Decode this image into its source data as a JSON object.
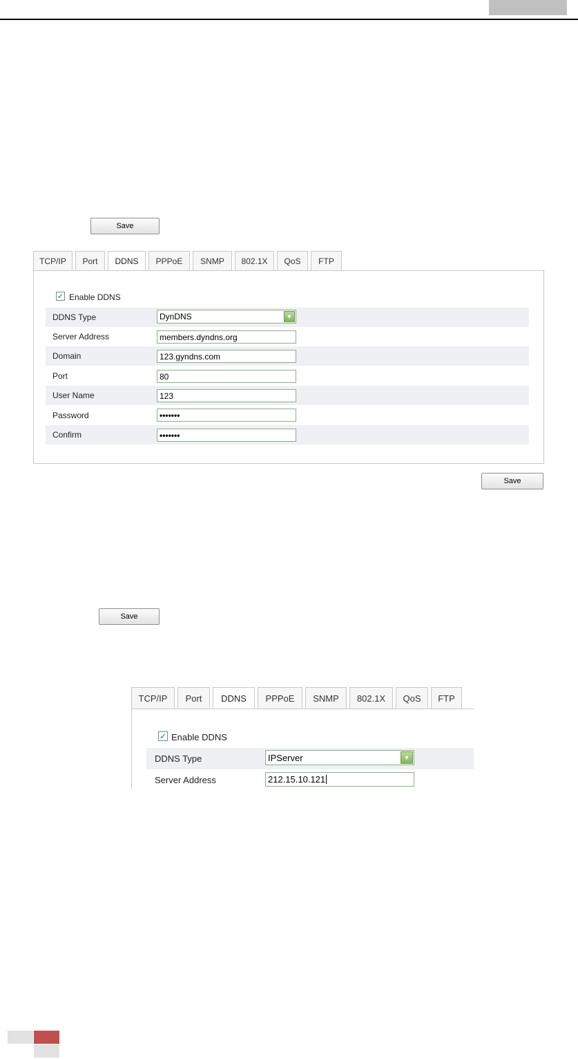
{
  "save_label": "Save",
  "tabs": [
    "TCP/IP",
    "Port",
    "DDNS",
    "PPPoE",
    "SNMP",
    "802.1X",
    "QoS",
    "FTP"
  ],
  "active_tab": "DDNS",
  "panel1": {
    "enable_label": "Enable DDNS",
    "enabled": true,
    "fields": [
      {
        "label": "DDNS Type",
        "value": "DynDNS",
        "kind": "select"
      },
      {
        "label": "Server Address",
        "value": "members.dyndns.org",
        "kind": "text"
      },
      {
        "label": "Domain",
        "value": "123.gyndns.com",
        "kind": "text"
      },
      {
        "label": "Port",
        "value": "80",
        "kind": "text"
      },
      {
        "label": "User Name",
        "value": "123",
        "kind": "text"
      },
      {
        "label": "Password",
        "value": "•••••••",
        "kind": "password"
      },
      {
        "label": "Confirm",
        "value": "•••••••",
        "kind": "password"
      }
    ]
  },
  "panel2": {
    "enable_label": "Enable DDNS",
    "enabled": true,
    "fields": [
      {
        "label": "DDNS Type",
        "value": "IPServer",
        "kind": "select"
      },
      {
        "label": "Server Address",
        "value": "212.15.10.121",
        "kind": "text"
      }
    ]
  },
  "colors": {
    "footer_accent": "#c0504d",
    "header_tab": "#c0c0c0",
    "check_mark": "#1c8a1c"
  }
}
